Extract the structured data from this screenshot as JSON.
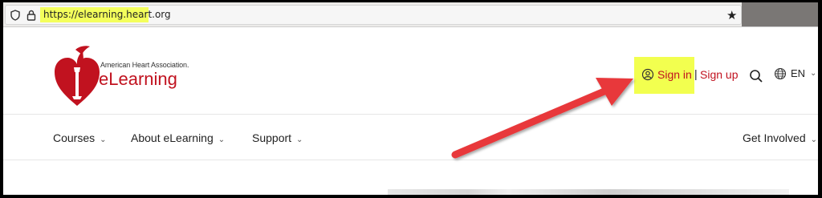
{
  "browser": {
    "url": "https://elearning.heart.org",
    "url_highlight_color": "#f4ff5c",
    "icons": [
      "shield-icon",
      "lock-icon",
      "star-icon"
    ]
  },
  "logo": {
    "org_name": "American Heart Association.",
    "product_name": "eLearning",
    "brand_color": "#c1121f"
  },
  "header": {
    "sign_in": "Sign in",
    "separator": "|",
    "sign_up": "Sign up",
    "language": "EN",
    "highlight_color": "#f2ff4f"
  },
  "nav": {
    "items": [
      {
        "label": "Courses"
      },
      {
        "label": "About eLearning"
      },
      {
        "label": "Support"
      },
      {
        "label": "Get Involved"
      }
    ]
  },
  "annotation": {
    "arrow_color": "#e8383a"
  }
}
